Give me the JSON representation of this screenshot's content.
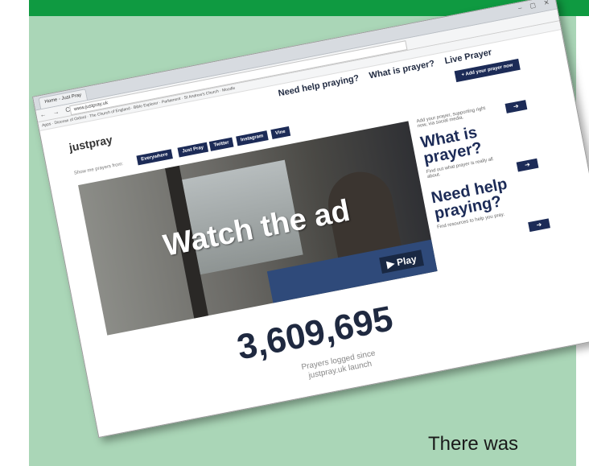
{
  "colors": {
    "brand_green": "#0f9a41",
    "panel_green": "#aad6b7",
    "navy": "#1c2b57"
  },
  "caption": "There was",
  "browser": {
    "tab_label": "Home - Just Pray",
    "url": "www.justpray.uk",
    "bookmarks": "Apps · Diocese of Oxford · The Church of England · Bible Explorer · Parliament · St Andrew's Church · Moodle",
    "window_buttons": "– ▢ ✕",
    "nav_icons": "← → C ⌂"
  },
  "site": {
    "logo": "justpray",
    "nav": [
      "Need help praying?",
      "What is prayer?",
      "Live Prayer"
    ],
    "add_prayer_button": "+ Add your prayer now",
    "filter_label": "Show me prayers from:",
    "filter_buttons": [
      "Everywhere",
      "Just Pray",
      "Twitter",
      "Instagram",
      "Vine"
    ],
    "hero_title": "Watch the ad",
    "play_label": "▶ Play",
    "side_intro": "Add your prayer, supporting right now, via social media.",
    "side_heading_1": "What is prayer?",
    "side_text_1": "Find out what prayer is really all about.",
    "side_heading_2": "Need help praying?",
    "side_text_2": "Find resources to help you pray.",
    "arrow": "➔",
    "counter": "3,609,695",
    "counter_caption": "Prayers logged since justpray.uk launch"
  }
}
